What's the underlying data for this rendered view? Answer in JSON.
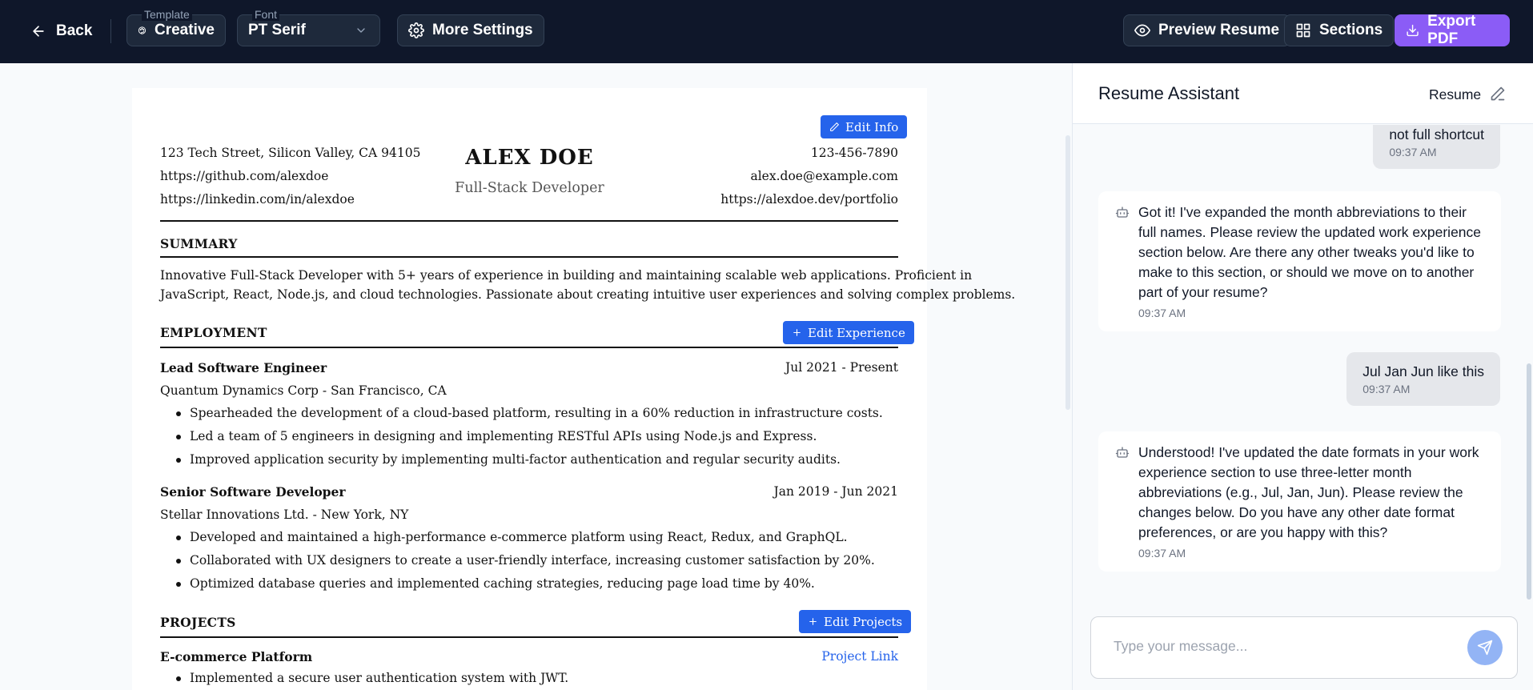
{
  "toolbar": {
    "back_label": "Back",
    "template_label": "Template",
    "template_value": "Creative",
    "font_label": "Font",
    "font_value": "PT Serif",
    "more_settings_label": "More Settings",
    "preview_label": "Preview Resume",
    "sections_label": "Sections",
    "export_label": "Export PDF",
    "accent_color": "#8b5cf6"
  },
  "resume": {
    "edit_info_label": "Edit Info",
    "name": "ALEX DOE",
    "title": "Full-Stack Developer",
    "address": "123 Tech Street, Silicon Valley, CA 94105",
    "github": "https://github.com/alexdoe",
    "linkedin": "https://linkedin.com/in/alexdoe",
    "phone": "123-456-7890",
    "email": "alex.doe@example.com",
    "portfolio": "https://alexdoe.dev/portfolio",
    "summary_title": "SUMMARY",
    "summary_line1": "Innovative Full-Stack Developer with 5+ years of experience in building and maintaining scalable web applications. Proficient in",
    "summary_line2": "JavaScript, React, Node.js, and cloud technologies. Passionate about creating intuitive user experiences and solving complex problems.",
    "employment_title": "EMPLOYMENT",
    "edit_experience_label": "Edit Experience",
    "jobs": [
      {
        "role": "Lead Software Engineer",
        "dates": "Jul 2021 - Present",
        "company": "Quantum Dynamics Corp - San Francisco, CA",
        "bullets": [
          "Spearheaded the development of a cloud-based platform, resulting in a 60% reduction in infrastructure costs.",
          "Led a team of 5 engineers in designing and implementing RESTful APIs using Node.js and Express.",
          "Improved application security by implementing multi-factor authentication and regular security audits."
        ]
      },
      {
        "role": "Senior Software Developer",
        "dates": "Jan 2019 - Jun 2021",
        "company": "Stellar Innovations Ltd. - New York, NY",
        "bullets": [
          "Developed and maintained a high-performance e-commerce platform using React, Redux, and GraphQL.",
          "Collaborated with UX designers to create a user-friendly interface, increasing customer satisfaction by 20%.",
          "Optimized database queries and implemented caching strategies, reducing page load time by 40%."
        ]
      }
    ],
    "projects_title": "PROJECTS",
    "edit_projects_label": "Edit Projects",
    "projects": [
      {
        "name": "E-commerce Platform",
        "link_label": "Project Link",
        "bullets": [
          "Implemented a secure user authentication system with JWT."
        ]
      }
    ]
  },
  "assistant": {
    "title": "Resume Assistant",
    "context_label": "Resume",
    "messages": [
      {
        "from": "user",
        "text": "not full shortcut",
        "time": "09:37 AM"
      },
      {
        "from": "bot",
        "text": "Got it! I've expanded the month abbreviations to their full names. Please review the updated work experience section below. Are there any other tweaks you'd like to make to this section, or should we move on to another part of your resume?",
        "time": "09:37 AM"
      },
      {
        "from": "user",
        "text": "Jul Jan Jun like this",
        "time": "09:37 AM"
      },
      {
        "from": "bot",
        "text": "Understood! I've updated the date formats in your work experience section to use three-letter month abbreviations (e.g., Jul, Jan, Jun). Please review the changes below. Do you have any other date format preferences, or are you happy with this?",
        "time": "09:37 AM"
      }
    ],
    "input_placeholder": "Type your message..."
  }
}
